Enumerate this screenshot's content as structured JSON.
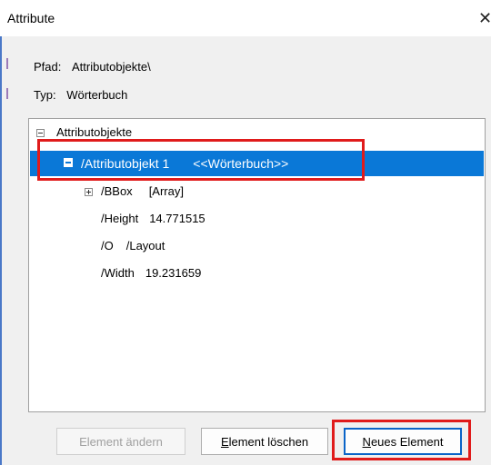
{
  "window": {
    "title": "Attribute",
    "close_glyph": "✕"
  },
  "info": {
    "path_label": "Pfad:",
    "path_value": "Attributobjekte\\",
    "type_label": "Typ:",
    "type_value": "Wörterbuch"
  },
  "tree": {
    "root": {
      "label": "Attributobjekte",
      "expanded": true
    },
    "selected": {
      "name": "/Attributobjekt 1",
      "type": "<<Wörterbuch>>",
      "expanded": true
    },
    "children": [
      {
        "key": "/BBox",
        "value": "[Array]",
        "expandable": true
      },
      {
        "key": "/Height",
        "value": "14.771515",
        "expandable": false
      },
      {
        "key": "/O",
        "value": "/Layout",
        "expandable": false
      },
      {
        "key": "/Width",
        "value": "19.231659",
        "expandable": false
      }
    ]
  },
  "buttons": {
    "edit": {
      "label": "Element ändern",
      "enabled": false
    },
    "delete_pre": "",
    "delete_mnemonic": "E",
    "delete_post": "lement löschen",
    "new_pre": "",
    "new_mnemonic": "N",
    "new_post": "eues Element"
  },
  "colors": {
    "selection": "#0a78d7",
    "annotation_red": "#e01b1b",
    "default_button_border": "#0a64c8"
  },
  "icons": {
    "close": "close-icon",
    "collapse": "minus-box-icon",
    "expand": "plus-box-icon"
  }
}
